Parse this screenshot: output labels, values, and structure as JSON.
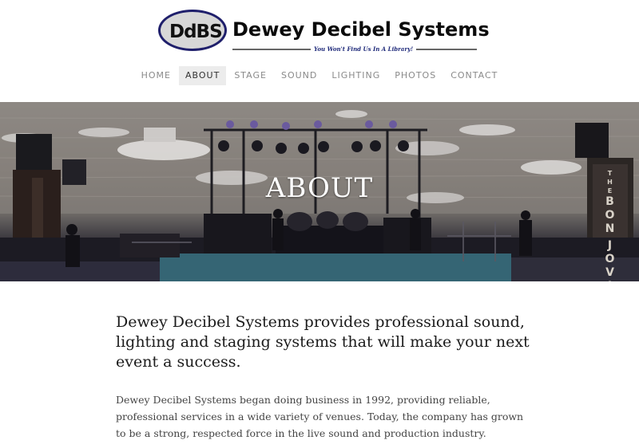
{
  "logo": {
    "monogram": "DdBS",
    "title": "Dewey Decibel Systems",
    "tagline": "You Won't Find Us In A Library!"
  },
  "nav": {
    "items": [
      {
        "label": "HOME",
        "active": false
      },
      {
        "label": "ABOUT",
        "active": true
      },
      {
        "label": "STAGE",
        "active": false
      },
      {
        "label": "SOUND",
        "active": false
      },
      {
        "label": "LIGHTING",
        "active": false
      },
      {
        "label": "PHOTOS",
        "active": false
      },
      {
        "label": "CONTACT",
        "active": false
      }
    ]
  },
  "hero": {
    "title": "ABOUT",
    "banner_text": "THE BON JOVI"
  },
  "content": {
    "lead": "Dewey Decibel Systems provides professional sound, lighting and staging systems that will make your next event a success.",
    "body": "Dewey Decibel Systems began doing business in 1992, providing reliable, professional services in a wide variety of venues. Today, the company has grown to be a strong, respected force in the live sound and production industry."
  },
  "colors": {
    "nav_text": "#8a8a8a",
    "nav_active_bg": "#ececec",
    "logo_accent": "#1f1f6b",
    "lead_text": "#1b1b1b",
    "body_text": "#444444"
  }
}
